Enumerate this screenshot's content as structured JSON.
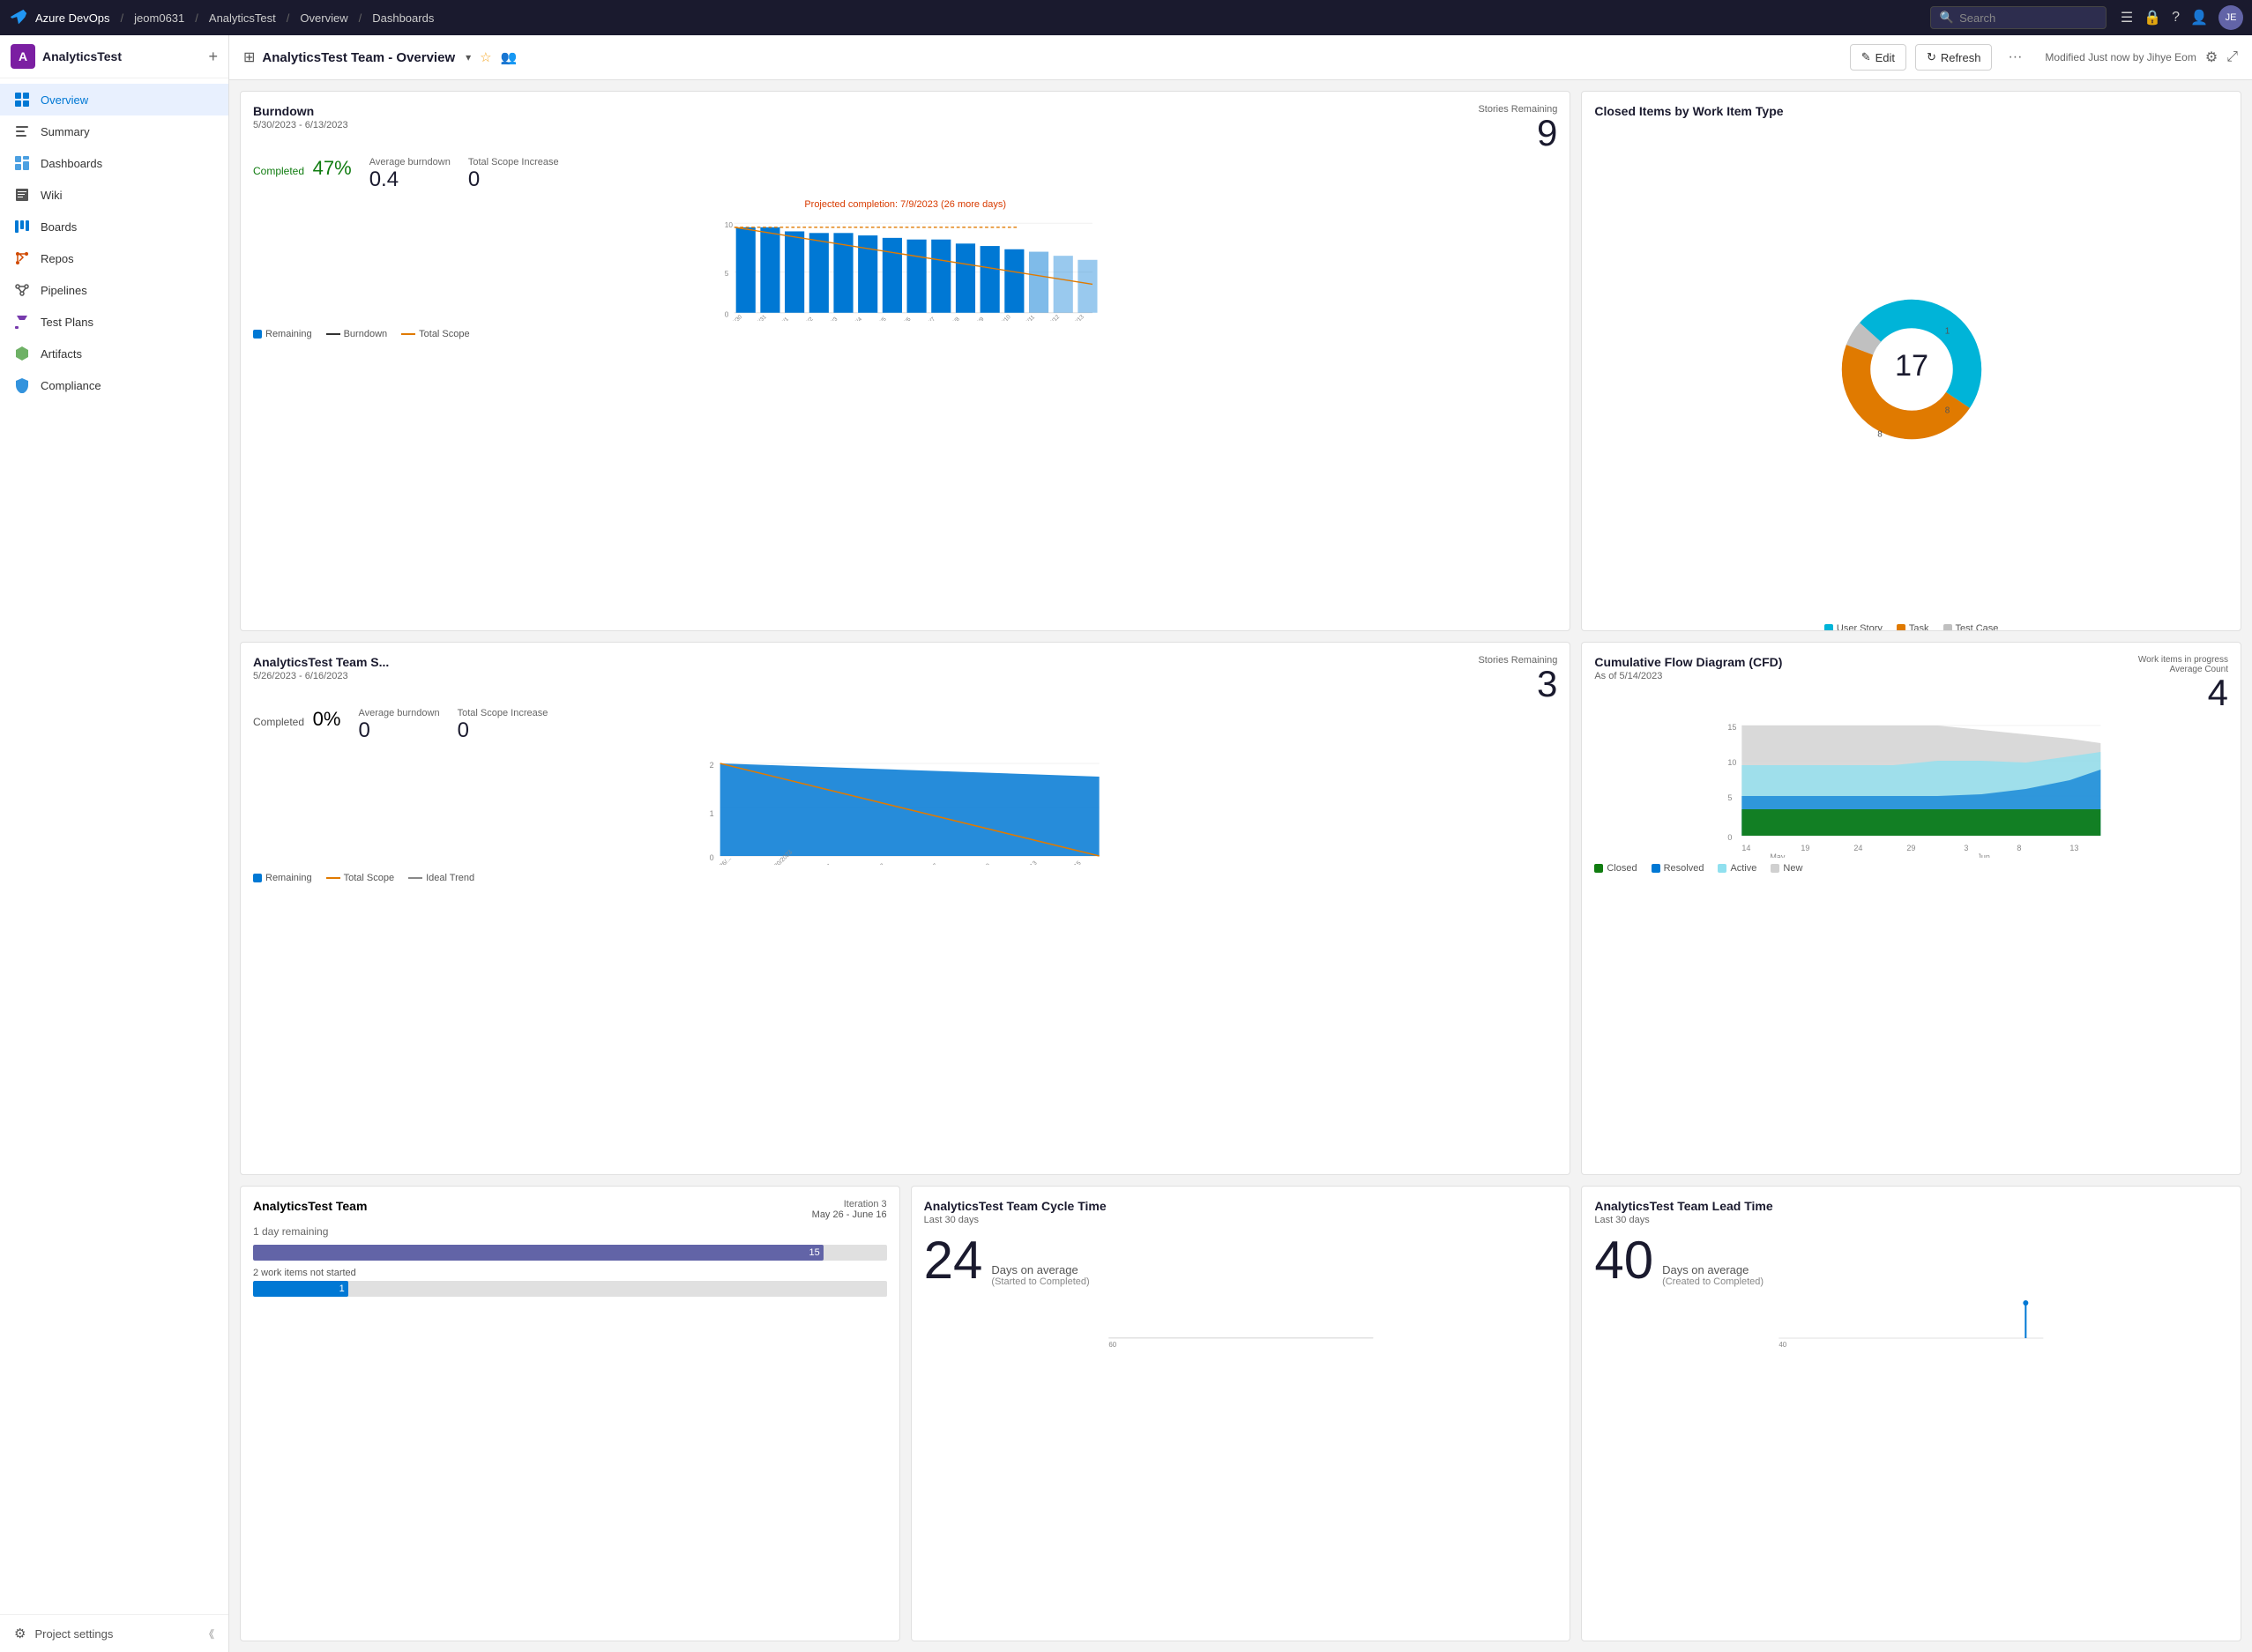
{
  "topnav": {
    "brand": "Azure DevOps",
    "org": "jeom0631",
    "project": "AnalyticsTest",
    "section": "Overview",
    "page": "Dashboards",
    "search_placeholder": "Search"
  },
  "sidebar": {
    "org_name": "AnalyticsTest",
    "org_initial": "A",
    "items": [
      {
        "id": "overview",
        "label": "Overview",
        "active": true
      },
      {
        "id": "summary",
        "label": "Summary",
        "active": false
      },
      {
        "id": "dashboards",
        "label": "Dashboards",
        "active": false
      },
      {
        "id": "wiki",
        "label": "Wiki",
        "active": false
      },
      {
        "id": "boards",
        "label": "Boards",
        "active": false
      },
      {
        "id": "repos",
        "label": "Repos",
        "active": false
      },
      {
        "id": "pipelines",
        "label": "Pipelines",
        "active": false
      },
      {
        "id": "testplans",
        "label": "Test Plans",
        "active": false
      },
      {
        "id": "artifacts",
        "label": "Artifacts",
        "active": false
      },
      {
        "id": "compliance",
        "label": "Compliance",
        "active": false
      }
    ],
    "footer": "Project settings"
  },
  "toolbar": {
    "dashboard_title": "AnalyticsTest Team - Overview",
    "edit_label": "Edit",
    "refresh_label": "Refresh",
    "modified_text": "Modified Just now by Jihye Eom"
  },
  "burndown": {
    "title": "Burndown",
    "date_range": "5/30/2023 - 6/13/2023",
    "completed_label": "Completed",
    "completed_value": "47%",
    "avg_burndown_label": "Average burndown",
    "avg_burndown_value": "0.4",
    "total_scope_label": "Total Scope Increase",
    "total_scope_value": "0",
    "stories_remaining_label": "Stories Remaining",
    "stories_remaining_value": "9",
    "projection": "Projected completion: 7/9/2023 (26 more days)",
    "legend": {
      "remaining": "Remaining",
      "burndown": "Burndown",
      "total_scope": "Total Scope"
    }
  },
  "closed_items": {
    "title": "Closed Items by Work Item Type",
    "total": "17",
    "segments": [
      {
        "label": "User Story",
        "value": 8,
        "color": "#00b4d8",
        "angle_start": 0,
        "angle_end": 169
      },
      {
        "label": "Task",
        "value": 8,
        "color": "#e07a00",
        "angle_start": 169,
        "angle_end": 338
      },
      {
        "label": "Test Case",
        "value": 1,
        "color": "#c0c0c0",
        "angle_start": 338,
        "angle_end": 360
      }
    ],
    "legend": [
      {
        "label": "User Story",
        "color": "#00b4d8"
      },
      {
        "label": "Task",
        "color": "#e07a00"
      },
      {
        "label": "Test Case",
        "color": "#c0c0c0"
      }
    ]
  },
  "sprint_burndown": {
    "title": "AnalyticsTest Team S...",
    "date_range": "5/26/2023 - 6/16/2023",
    "completed_label": "Completed",
    "completed_value": "0%",
    "avg_burndown_label": "Average burndown",
    "avg_burndown_value": "0",
    "total_scope_label": "Total Scope Increase",
    "total_scope_value": "0",
    "stories_remaining_label": "Stories Remaining",
    "stories_remaining_value": "3",
    "legend": {
      "remaining": "Remaining",
      "total_scope": "Total Scope",
      "ideal_trend": "Ideal Trend"
    }
  },
  "cfd": {
    "title": "Cumulative Flow Diagram (CFD)",
    "subtitle": "As of 5/14/2023",
    "metric_label": "Work items in progress Average Count",
    "metric_value": "4",
    "legend": [
      {
        "label": "Closed",
        "color": "#107c10"
      },
      {
        "label": "Resolved",
        "color": "#0078d4"
      },
      {
        "label": "Active",
        "color": "#90e0ef"
      },
      {
        "label": "New",
        "color": "#d0d0d0"
      }
    ],
    "x_labels": [
      "14",
      "19",
      "24",
      "29",
      "3",
      "8",
      "13"
    ],
    "x_months": [
      "May",
      "",
      "",
      "",
      "Jun",
      "",
      ""
    ]
  },
  "iteration": {
    "title": "AnalyticsTest Team",
    "iteration_label": "Iteration 3",
    "dates": "May 26 - June 16",
    "remaining": "1 day remaining",
    "not_started_label": "2 work items not started",
    "bar1_value": "15",
    "bar2_value": "1"
  },
  "cycle_time": {
    "title": "AnalyticsTest Team Cycle Time",
    "subtitle": "Last 30 days",
    "value": "24",
    "days_label": "Days on average",
    "sub_label": "(Started to Completed)"
  },
  "lead_time": {
    "title": "AnalyticsTest Team Lead Time",
    "subtitle": "Last 30 days",
    "value": "40",
    "days_label": "Days on average",
    "sub_label": "(Created to Completed)"
  }
}
